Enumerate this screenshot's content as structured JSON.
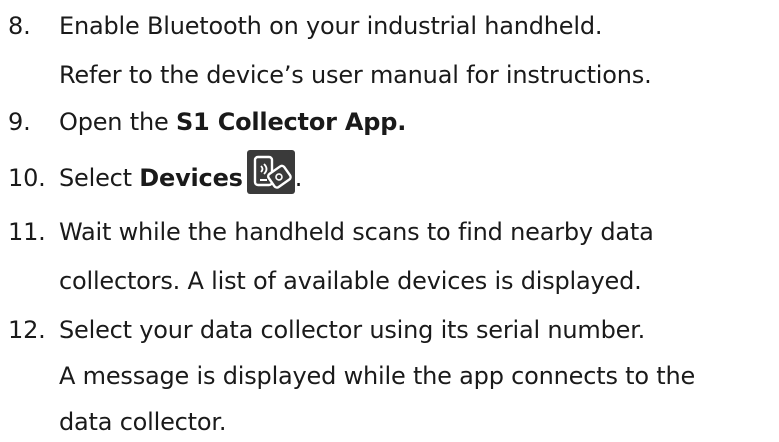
{
  "steps": [
    {
      "number": "8.",
      "text": "Enable Bluetooth on your industrial handheld.",
      "continuation": "Refer to the device’s user manual for instructions."
    },
    {
      "number": "9.",
      "prefix": "Open the ",
      "bold": "S1 Collector App."
    },
    {
      "number": "10.",
      "prefix": "Select ",
      "bold": "Devices",
      "suffix": ".",
      "icon": "devices-icon"
    },
    {
      "number": "11.",
      "text": "Wait while the handheld scans to find nearby data",
      "continuation": "collectors. A list of available devices is displayed."
    },
    {
      "number": "12.",
      "text": "Select your data collector using its serial number.",
      "continuation": "A message is displayed while the app connects to the",
      "continuation2": "data collector."
    }
  ],
  "colors": {
    "text": "#1a1a1a",
    "icon_bg": "#3a3a3a"
  }
}
